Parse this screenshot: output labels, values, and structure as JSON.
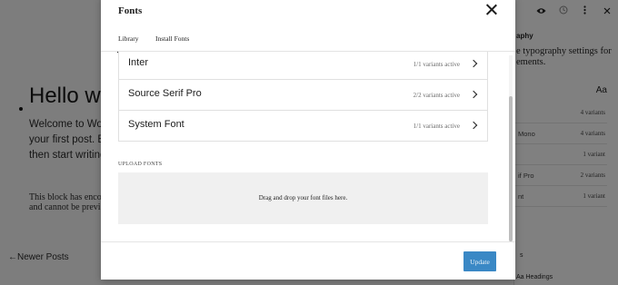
{
  "canvas": {
    "title": "Hello wo",
    "paragraph": [
      "Welcome to Word",
      "your first post. Edi",
      "then start writing!"
    ],
    "warning": [
      "This block has encou",
      "and cannot be previe"
    ],
    "newer_posts": "←Newer Posts"
  },
  "sidebar": {
    "toolbar_icons": [
      "eye-icon",
      "history-icon",
      "more-vertical-icon"
    ],
    "heading": "aphy",
    "description": "e typography settings for ements.",
    "aa": "Aa",
    "rows": [
      {
        "name": "",
        "count": "4 variants"
      },
      {
        "name": "Mono",
        "count": "4 variants"
      },
      {
        "name": "",
        "count": "1 variant"
      },
      {
        "name": "if Pro",
        "count": "2 variants"
      },
      {
        "name": "nt",
        "count": "1 variant"
      }
    ],
    "bottom_link": "s",
    "bottom_headings": "Aa  Headings"
  },
  "modal": {
    "title": "Fonts",
    "close_icon": "close-icon",
    "tabs": [
      {
        "label": "Library",
        "active": true
      },
      {
        "label": "Install Fonts",
        "active": false
      }
    ],
    "fonts": [
      {
        "name": "Inter",
        "status": "1/1 variants active"
      },
      {
        "name": "Source Serif Pro",
        "status": "2/2 variants active"
      },
      {
        "name": "System Font",
        "status": "1/1 variants active"
      }
    ],
    "upload_label": "UPLOAD FONTS",
    "dropzone_text": "Drag and drop your font files here.",
    "update_label": "Update"
  },
  "colors": {
    "overlay_bg": "#7e7e7e",
    "accent": "#3a88c5",
    "dropzone_bg": "#f0f0f0"
  }
}
